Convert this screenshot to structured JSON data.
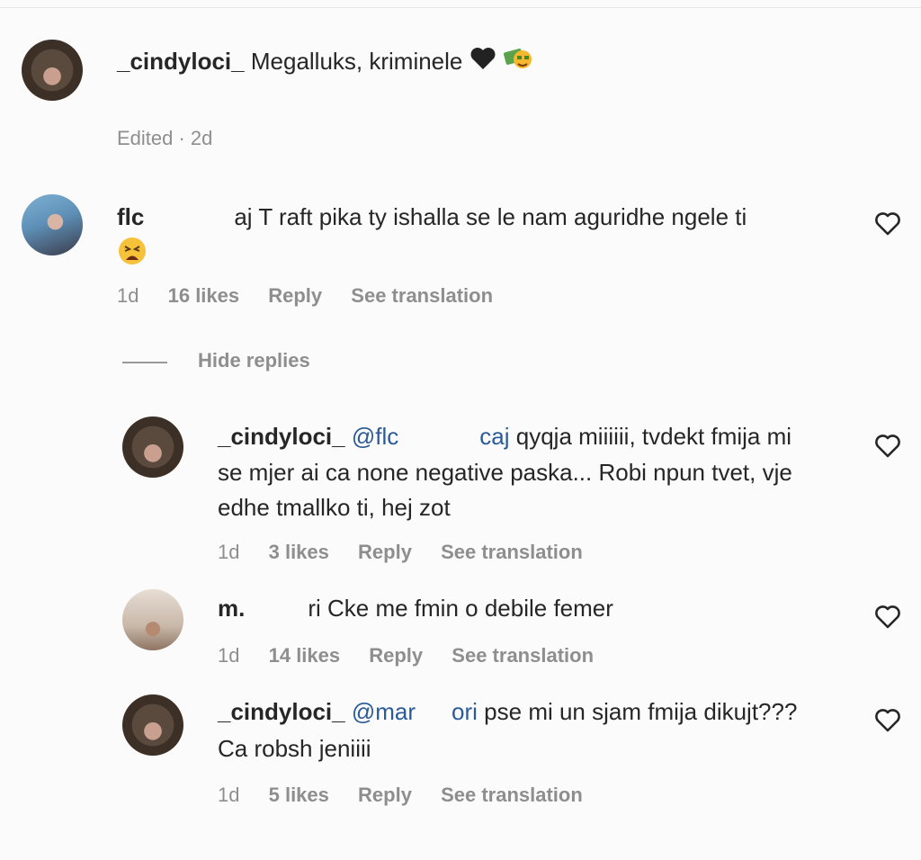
{
  "comments": [
    {
      "username": "_cindyloci_",
      "text": "Megalluks, kriminele",
      "emojis": [
        "black-heart",
        "money-bag-face"
      ],
      "meta": {
        "time": "Edited · 2d"
      }
    },
    {
      "username": "flc",
      "text_line1": "aj T raft pika ty ishalla se le nam aguridhe ngele ti",
      "emojis": [
        "tired-face"
      ],
      "meta": {
        "time": "1d",
        "likes": "16 likes",
        "reply": "Reply",
        "translate": "See translation"
      }
    }
  ],
  "hide_replies": "Hide replies",
  "replies": [
    {
      "username": "_cindyloci_",
      "mention": "@flc",
      "mention_tail": "caj",
      "line1_rest": "qyqja miiiiii, tvdekt fmija mi",
      "line2": "se mjer ai ca none negative paska... Robi npun tvet, vje",
      "line3": "edhe tmallko ti, hej zot",
      "meta": {
        "time": "1d",
        "likes": "3 likes",
        "reply": "Reply",
        "translate": "See translation"
      }
    },
    {
      "username": "m.",
      "text": "ri Cke me fmin o debile femer",
      "meta": {
        "time": "1d",
        "likes": "14 likes",
        "reply": "Reply",
        "translate": "See translation"
      }
    },
    {
      "username": "_cindyloci_",
      "mention": "@mar",
      "mention_tail": "ori",
      "line1_rest": "pse mi un sjam fmija dikujt???",
      "line2": "Ca robsh jeniiii",
      "meta": {
        "time": "1d",
        "likes": "5 likes",
        "reply": "Reply",
        "translate": "See translation"
      }
    }
  ]
}
